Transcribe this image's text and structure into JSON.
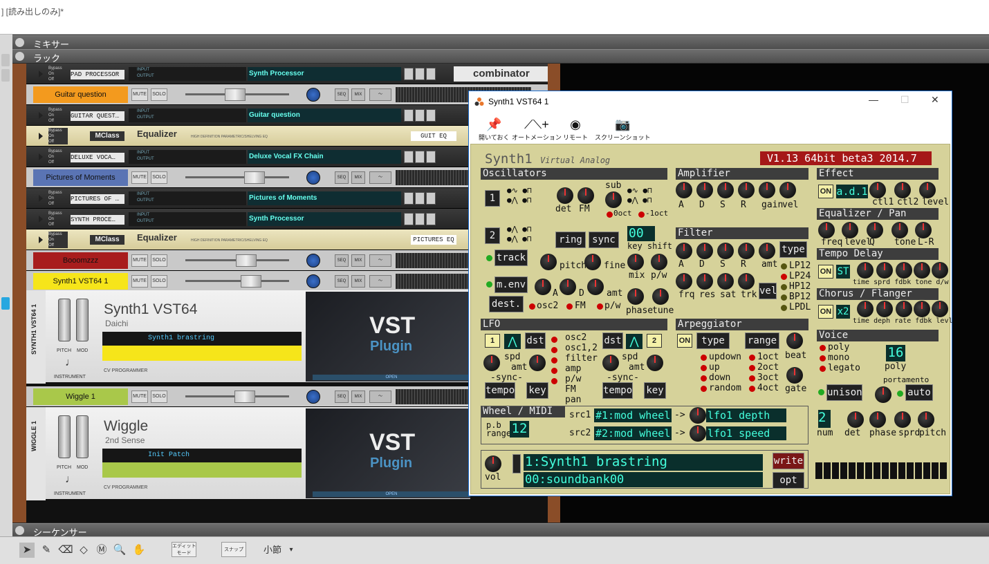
{
  "app_title": "] [読み出しのみ]*",
  "sections": {
    "mixer": "ミキサー",
    "rack": "ラック",
    "sequencer": "シーケンサー"
  },
  "combinator": "combinator",
  "rack_rows": [
    {
      "type": "combi",
      "label": "PAD PROCESSOR",
      "display": "Synth Processor"
    },
    {
      "type": "channel",
      "name": "Guitar question",
      "color": "#f39a1e"
    },
    {
      "type": "combi",
      "label": "GUITAR QUEST…",
      "display": "Guitar question"
    },
    {
      "type": "eq",
      "brand": "MClass",
      "title": "Equalizer",
      "tag": "GUIT EQ"
    },
    {
      "type": "combi",
      "label": "DELUXE VOCA…",
      "display": "Deluxe Vocal FX Chain"
    },
    {
      "type": "channel",
      "name": "Pictures of Moments",
      "color": "#5a74b4"
    },
    {
      "type": "combi",
      "label": "PICTURES OF …",
      "display": "Pictures of Moments"
    },
    {
      "type": "combi",
      "label": "SYNTH PROCE…",
      "display": "Synth Processor"
    },
    {
      "type": "eq",
      "brand": "MClass",
      "title": "Equalizer",
      "tag": "PICTURES EQ"
    },
    {
      "type": "channel",
      "name": "Booomzzz",
      "color": "#a81d1d"
    },
    {
      "type": "channel",
      "name": "Synth1 VST64 1",
      "color": "#f6e51a"
    }
  ],
  "eq_subtitle": "HIGH DEFINITION PARAMETRIC/SHELVING EQ",
  "strip_labels": {
    "mute": "MUTE",
    "solo": "SOLO",
    "seq": "SEQ",
    "mix": "MIX",
    "bypass": "Bypass",
    "on": "On",
    "off": "Off",
    "input": "INPUT",
    "output": "OUTPUT",
    "routing_int": "INTERNAL ROUTING",
    "routing_ext": "EXTERNAL ROUTING",
    "pitch": "PITCH",
    "mod": "MOD",
    "instrument": "INSTRUMENT",
    "cv": "CV PROGRAMMER",
    "open": "OPEN"
  },
  "vst_devices": [
    {
      "side": "SYNTH1 VST64 1",
      "name": "Synth1 VST64",
      "maker": "Daichi",
      "patch": "Synth1 brastring",
      "color": "#f6e51a"
    },
    {
      "side": "WIGGLE 1",
      "name": "Wiggle",
      "maker": "2nd Sense",
      "patch": "Init Patch",
      "color": "#a9c84a"
    }
  ],
  "wiggle_channel": {
    "name": "Wiggle 1",
    "color": "#a9c84a"
  },
  "vst_logo": {
    "line1": "VST",
    "line2": "Plugin"
  },
  "window": {
    "title": "Synth1 VST64 1",
    "controls": [
      "—",
      "☐",
      "✕"
    ],
    "toolbar": [
      {
        "label": "開いておく",
        "icon": "pin-icon"
      },
      {
        "label": "オートメーション",
        "icon": "automation-icon"
      },
      {
        "label": "リモート",
        "icon": "remote-icon"
      },
      {
        "label": "スクリーンショット",
        "icon": "camera-icon"
      }
    ]
  },
  "synth": {
    "name": "Synth1",
    "subtitle": "Virtual Analog",
    "version": "V1.13 64bit beta3 2014.7",
    "oscillators": "Oscillators",
    "amplifier": "Amplifier",
    "effect": "Effect",
    "eqpan": "Equalizer / Pan",
    "filter": "Filter",
    "tempo_delay": "Tempo Delay",
    "chorus": "Chorus / Flanger",
    "lfo": "LFO",
    "arp": "Arpeggiator",
    "voice": "Voice",
    "wheel": "Wheel / MIDI",
    "osc1_num": "1",
    "osc2_num": "2",
    "det": "det",
    "fm": "FM",
    "sub": "sub",
    "oct0": "0oct",
    "octm1": "-1oct",
    "ring": "ring",
    "sync": "sync",
    "key_shift_val": "00",
    "key_shift": "key shift",
    "track": "track",
    "pitch": "pitch",
    "fine": "fine",
    "mix": "mix",
    "pw": "p/w",
    "menv": "m.env",
    "dest": "dest.",
    "osc2": "osc2",
    "fm2": "FM",
    "pw2": "p/w",
    "phase": "phase",
    "tune": "tune",
    "amt": "amt",
    "amp_labels": [
      "A",
      "D",
      "S",
      "R",
      "gain",
      "vel"
    ],
    "filt_labels": [
      "A",
      "D",
      "S",
      "R",
      "amt"
    ],
    "filt_labels2": [
      "frq",
      "res",
      "sat",
      "trk"
    ],
    "vel": "vel",
    "type": "type",
    "filter_types": [
      "LP12",
      "LP24",
      "HP12",
      "BP12",
      "LPDL"
    ],
    "effect_on": "ON",
    "effect_type": "a.d.1",
    "effect_labels": [
      "ctl1",
      "ctl2",
      "level"
    ],
    "eq_labels": [
      "freq",
      "level",
      "Q",
      "tone",
      "L-R"
    ],
    "delay_on": "ON",
    "delay_type": "ST",
    "delay_labels": "time sprd fdbk tone d/w",
    "chorus_on": "ON",
    "chorus_type": "x2",
    "chorus_labels": "time deph rate fdbk levl",
    "lfo1": "1",
    "lfo2": "2",
    "dst": "dst",
    "spd": "spd",
    "lfo_dest1": [
      "osc2",
      "osc1,2",
      "filter",
      "amp",
      "p/w",
      "FM",
      "pan"
    ],
    "sync_lbl": "-sync-",
    "tempo": "tempo",
    "key": "key",
    "arp_on": "ON",
    "arp_type": "type",
    "arp_range": "range",
    "arp_beat": "beat",
    "arp_gate": "gate",
    "arp_modes": [
      "updown",
      "up",
      "down",
      "random"
    ],
    "arp_ranges": [
      "1oct",
      "2oct",
      "3oct",
      "4oct"
    ],
    "voice_modes": [
      "poly",
      "mono",
      "legato"
    ],
    "poly_val": "16",
    "poly": "poly",
    "unison": "unison",
    "portamento": "portamento",
    "auto": "auto",
    "uni_num": "2",
    "uni_labels": [
      "num",
      "det",
      "phase",
      "sprd",
      "pitch"
    ],
    "pb": "p.b",
    "range": "range",
    "pb_val": "12",
    "src1": "src1",
    "src2": "src2",
    "src1_val": "#1:mod wheel",
    "src2_val": "#2:mod wheel",
    "arrow": "->",
    "dst1_val": "lfo1 depth",
    "dst2_val": "lfo1 speed",
    "patch": "1:Synth1 brastring",
    "bank": "00:soundbank00",
    "write": "write",
    "opt": "opt",
    "vol": "vol"
  },
  "seq_tools": {
    "edit_mode": "エディット\nモード",
    "snap": "スナップ",
    "bar": "小節"
  }
}
